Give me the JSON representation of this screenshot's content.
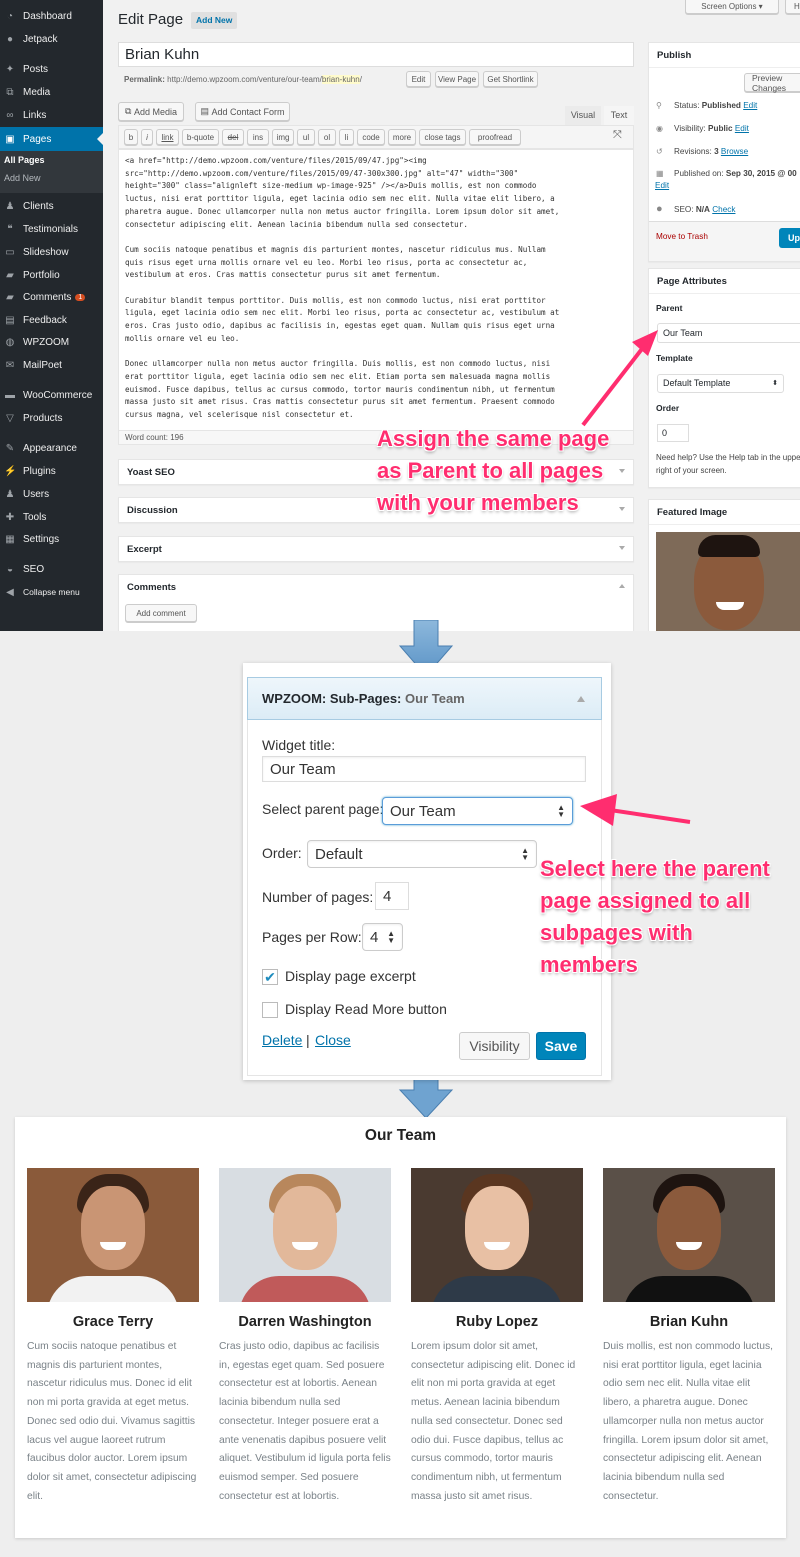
{
  "sidebar": {
    "items": [
      {
        "label": "Dashboard",
        "icon": "dashboard-icon"
      },
      {
        "label": "Jetpack",
        "icon": "jetpack-icon"
      },
      {
        "label": "Posts",
        "icon": "pin-icon"
      },
      {
        "label": "Media",
        "icon": "media-icon"
      },
      {
        "label": "Links",
        "icon": "link-icon"
      },
      {
        "label": "Pages",
        "icon": "pages-icon"
      },
      {
        "label": "Clients",
        "icon": "clients-icon"
      },
      {
        "label": "Testimonials",
        "icon": "quote-icon"
      },
      {
        "label": "Slideshow",
        "icon": "slideshow-icon"
      },
      {
        "label": "Portfolio",
        "icon": "folder-icon"
      },
      {
        "label": "Comments",
        "icon": "comment-icon"
      },
      {
        "label": "Feedback",
        "icon": "feedback-icon"
      },
      {
        "label": "WPZOOM",
        "icon": "wpzoom-icon"
      },
      {
        "label": "MailPoet",
        "icon": "mail-icon"
      },
      {
        "label": "WooCommerce",
        "icon": "woo-icon"
      },
      {
        "label": "Products",
        "icon": "cart-icon"
      },
      {
        "label": "Appearance",
        "icon": "brush-icon"
      },
      {
        "label": "Plugins",
        "icon": "plugin-icon"
      },
      {
        "label": "Users",
        "icon": "users-icon"
      },
      {
        "label": "Tools",
        "icon": "wrench-icon"
      },
      {
        "label": "Settings",
        "icon": "settings-icon"
      },
      {
        "label": "SEO",
        "icon": "seo-icon"
      },
      {
        "label": "Collapse menu",
        "icon": "collapse-icon"
      }
    ],
    "submenu": [
      "All Pages",
      "Add New"
    ],
    "comments_badge": "1"
  },
  "header": {
    "title": "Edit Page",
    "add_new": "Add New",
    "screen_options": "Screen Options",
    "help": "H"
  },
  "editor": {
    "post_title": "Brian Kuhn",
    "permalink_label": "Permalink:",
    "permalink_base": "http://demo.wpzoom.com/venture/our-team/",
    "permalink_slug": "brian-kuhn",
    "permalink_end": "/",
    "permalink_buttons": [
      "Edit",
      "View Page",
      "Get Shortlink"
    ],
    "add_media": "Add Media",
    "add_contact_form": "Add Contact Form",
    "tabs": [
      "Visual",
      "Text"
    ],
    "quicktags": [
      "b",
      "i",
      "link",
      "b-quote",
      "del",
      "ins",
      "img",
      "ul",
      "ol",
      "li",
      "code",
      "more",
      "close tags",
      "proofread"
    ],
    "content": "<a href=\"http://demo.wpzoom.com/venture/files/2015/09/47.jpg\"><img\nsrc=\"http://demo.wpzoom.com/venture/files/2015/09/47-300x300.jpg\" alt=\"47\" width=\"300\"\nheight=\"300\" class=\"alignleft size-medium wp-image-925\" /></a>Duis mollis, est non commodo\nluctus, nisi erat porttitor ligula, eget lacinia odio sem nec elit. Nulla vitae elit libero, a\npharetra augue. Donec ullamcorper nulla non metus auctor fringilla. Lorem ipsum dolor sit amet,\nconsectetur adipiscing elit. Aenean lacinia bibendum nulla sed consectetur.\n\nCum sociis natoque penatibus et magnis dis parturient montes, nascetur ridiculus mus. Nullam\nquis risus eget urna mollis ornare vel eu leo. Morbi leo risus, porta ac consectetur ac,\nvestibulum at eros. Cras mattis consectetur purus sit amet fermentum.\n\nCurabitur blandit tempus porttitor. Duis mollis, est non commodo luctus, nisi erat porttitor\nligula, eget lacinia odio sem nec elit. Morbi leo risus, porta ac consectetur ac, vestibulum at\neros. Cras justo odio, dapibus ac facilisis in, egestas eget quam. Nullam quis risus eget urna\nmollis ornare vel eu leo.\n\nDonec ullamcorper nulla non metus auctor fringilla. Duis mollis, est non commodo luctus, nisi\nerat porttitor ligula, eget lacinia odio sem nec elit. Etiam porta sem malesuada magna mollis\neuismod. Fusce dapibus, tellus ac cursus commodo, tortor mauris condimentum nibh, ut fermentum\nmassa justo sit amet risus. Cras mattis consectetur purus sit amet fermentum. Praesent commodo\ncursus magna, vel scelerisque nisl consectetur et.",
    "word_count": "Word count: 196",
    "metaboxes": [
      "Yoast SEO",
      "Discussion",
      "Excerpt",
      "Comments"
    ],
    "add_comment": "Add comment"
  },
  "publish": {
    "title": "Publish",
    "preview": "Preview Changes",
    "status_label": "Status:",
    "status": "Published",
    "visibility_label": "Visibility:",
    "visibility": "Public",
    "revisions_label": "Revisions:",
    "revisions": "3",
    "browse": "Browse",
    "published_label": "Published on:",
    "published": "Sep 30, 2015 @ 00",
    "seo_label": "SEO:",
    "seo": "N/A",
    "check": "Check",
    "edit": "Edit",
    "trash": "Move to Trash",
    "update": "Update"
  },
  "attributes": {
    "title": "Page Attributes",
    "parent_label": "Parent",
    "parent": "Our Team",
    "template_label": "Template",
    "template": "Default Template",
    "order_label": "Order",
    "order": "0",
    "help": "Need help? Use the Help tab in the upper right of your screen."
  },
  "featured": {
    "title": "Featured Image"
  },
  "annotations": {
    "first": [
      "Assign the same page",
      "as Parent to all pages",
      "with your members"
    ],
    "second": [
      "Select here the parent",
      "page assigned to all",
      "subpages with",
      "members"
    ],
    "color": "#ff2d6f"
  },
  "widget": {
    "header_prefix": "WPZOOM: Sub-Pages:",
    "header_title": "Our Team",
    "title_label": "Widget title:",
    "title_value": "Our Team",
    "parent_label": "Select parent page:",
    "parent_value": "Our Team",
    "order_label": "Order:",
    "order_value": "Default",
    "num_label": "Number of pages:",
    "num_value": "4",
    "row_label": "Pages per Row:",
    "row_value": "4",
    "excerpt_label": "Display page excerpt",
    "excerpt_checked": true,
    "readmore_label": "Display Read More button",
    "readmore_checked": false,
    "delete": "Delete",
    "sep": "|",
    "close": "Close",
    "visibility": "Visibility",
    "save": "Save"
  },
  "team": {
    "title": "Our Team",
    "members": [
      {
        "name": "Grace Terry",
        "text": "Cum sociis natoque penatibus et magnis dis parturient montes, nascetur ridiculus mus. Donec id elit non mi porta gravida at eget metus. Donec sed odio dui. Vivamus sagittis lacus vel augue laoreet rutrum faucibus dolor auctor. Lorem ipsum dolor sit amet, consectetur adipiscing elit."
      },
      {
        "name": "Darren Washington",
        "text": "Cras justo odio, dapibus ac facilisis in, egestas eget quam. Sed posuere consectetur est at lobortis. Aenean lacinia bibendum nulla sed consectetur. Integer posuere erat a ante venenatis dapibus posuere velit aliquet. Vestibulum id ligula porta felis euismod semper. Sed posuere consectetur est at lobortis."
      },
      {
        "name": "Ruby Lopez",
        "text": "Lorem ipsum dolor sit amet, consectetur adipiscing elit. Donec id elit non mi porta gravida at eget metus. Aenean lacinia bibendum nulla sed consectetur. Donec sed odio dui. Fusce dapibus, tellus ac cursus commodo, tortor mauris condimentum nibh, ut fermentum massa justo sit amet risus."
      },
      {
        "name": "Brian Kuhn",
        "text": "Duis mollis, est non commodo luctus, nisi erat porttitor ligula, eget lacinia odio sem nec elit. Nulla vitae elit libero, a pharetra augue. Donec ullamcorper nulla non metus auctor fringilla. Lorem ipsum dolor sit amet, consectetur adipiscing elit. Aenean lacinia bibendum nulla sed consectetur."
      }
    ]
  }
}
